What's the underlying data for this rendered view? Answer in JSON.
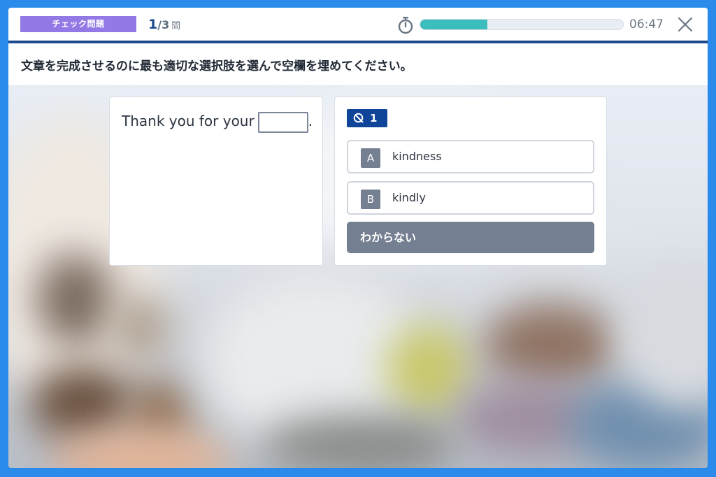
{
  "header": {
    "badge": "チェック問題",
    "counter_current": "1",
    "counter_total": "/3",
    "counter_unit": "問",
    "progress_fraction": 0.33,
    "time": "06:47"
  },
  "instruction": "文章を完成させるのに最も適切な選択肢を選んで空欄を埋めてください。",
  "question": {
    "sentence_before": "Thank you for your",
    "sentence_after": ".",
    "number": "1"
  },
  "options": [
    {
      "letter": "A",
      "text": "kindness"
    },
    {
      "letter": "B",
      "text": "kindly"
    }
  ],
  "dont_know": "わからない",
  "colors": {
    "badge": "#9379e6",
    "accent": "#1c4a8e",
    "progress": "#3cbdbd",
    "question_badge": "#0f4599",
    "option_letter": "#747f92"
  }
}
